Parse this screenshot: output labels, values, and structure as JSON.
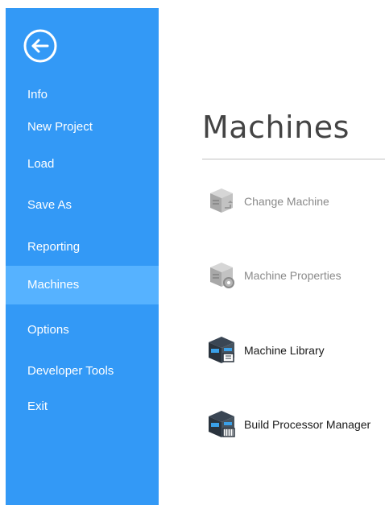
{
  "sidebar": {
    "back_icon": "back-arrow-circle-icon",
    "items": [
      {
        "label": "Info"
      },
      {
        "label": "New Project"
      },
      {
        "label": "Load"
      },
      {
        "label": "Save As"
      },
      {
        "label": "Reporting"
      },
      {
        "label": "Machines",
        "active": true
      },
      {
        "label": "Options"
      },
      {
        "label": "Developer Tools"
      },
      {
        "label": "Exit"
      }
    ]
  },
  "main": {
    "title": "Machines",
    "commands": [
      {
        "label": "Change Machine",
        "enabled": false,
        "icon": "change-machine-icon"
      },
      {
        "label": "Machine Properties",
        "enabled": false,
        "icon": "machine-properties-icon"
      },
      {
        "label": "Machine Library",
        "enabled": true,
        "icon": "machine-library-icon"
      },
      {
        "label": "Build Processor Manager",
        "enabled": true,
        "icon": "build-processor-manager-icon"
      }
    ]
  },
  "colors": {
    "sidebar_bg": "#3399f6",
    "sidebar_active": "#56b2ff",
    "disabled_text": "#8a8a8a"
  }
}
